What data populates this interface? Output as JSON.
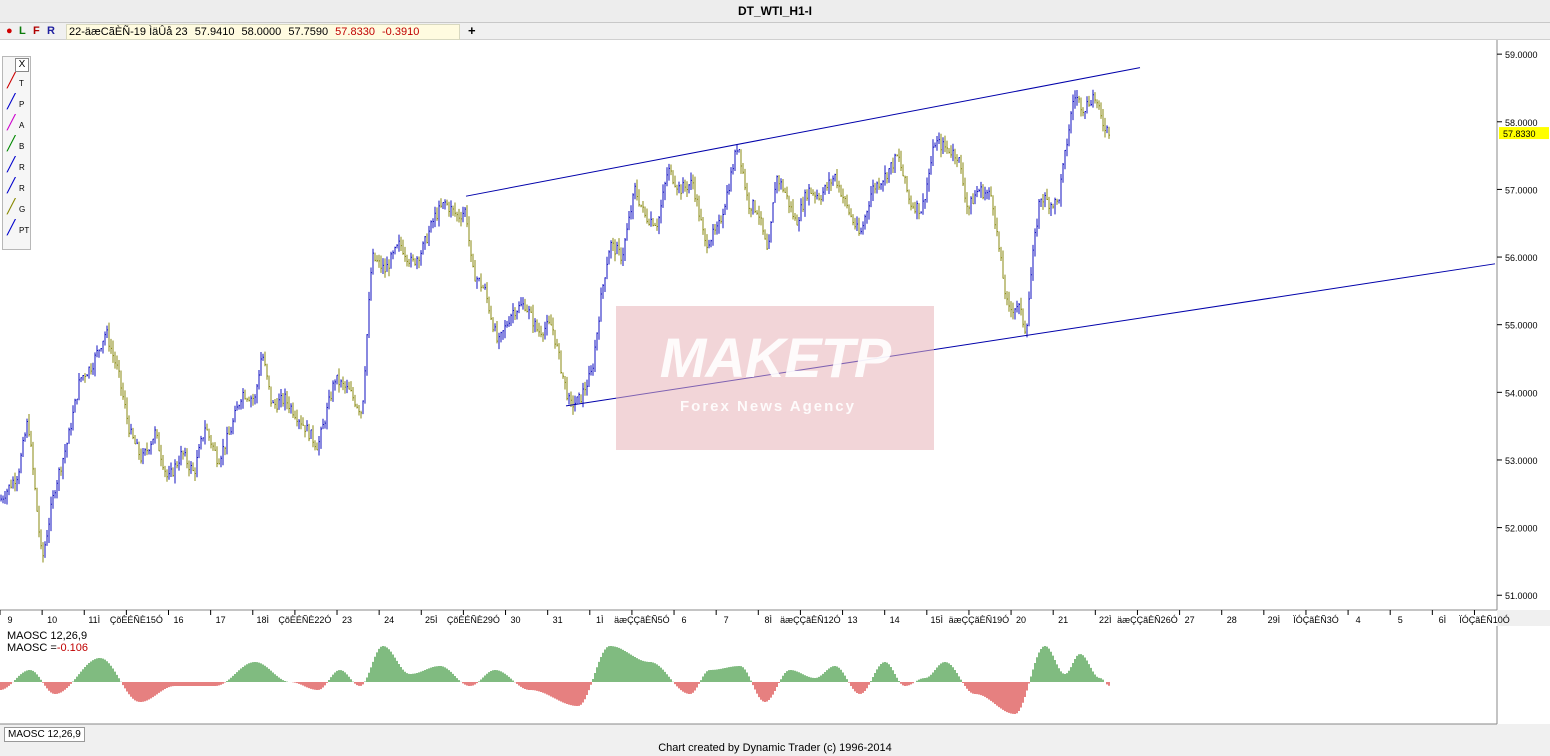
{
  "window": {
    "title": "DT_WTI_H1-I"
  },
  "toolbar": {
    "btn_dot": "●",
    "btn_l": "L",
    "btn_f": "F",
    "btn_r": "R",
    "ohlc": {
      "date": "22-äæCãÈÑ-19 ÌäÛå 23",
      "open": "57.9410",
      "high": "58.0000",
      "low": "57.7590",
      "close": "57.8330",
      "change": "-0.3910"
    },
    "add": "+"
  },
  "tools": {
    "close": "X",
    "items": [
      {
        "icon": "trend-line-icon",
        "sub": "T",
        "color": "#cc0000"
      },
      {
        "icon": "parallel-lines-icon",
        "sub": "P",
        "color": "#0000cc"
      },
      {
        "icon": "andrews-pitchfork-icon",
        "sub": "A",
        "color": "#cc00cc"
      },
      {
        "icon": "b-line-icon",
        "sub": "B",
        "color": "#008800"
      },
      {
        "icon": "r-ratio-icon",
        "sub": "R",
        "color": "#0000cc"
      },
      {
        "icon": "r-channel-icon",
        "sub": "R",
        "color": "#0000cc"
      },
      {
        "icon": "g-fan-icon",
        "sub": "G",
        "color": "#888800"
      },
      {
        "icon": "pt-icon",
        "sub": "PT",
        "color": "#0000cc"
      }
    ]
  },
  "watermark": {
    "logo": "MAKETP",
    "subtitle": "Forex News Agency"
  },
  "chart_data": {
    "type": "ohlc",
    "y_axis": {
      "range": [
        50.9,
        59.15
      ],
      "ticks": [
        "51.0000",
        "52.0000",
        "53.0000",
        "54.0000",
        "55.0000",
        "56.0000",
        "57.0000",
        "58.0000",
        "59.0000"
      ]
    },
    "last_price": "57.8330",
    "colors": {
      "up_bars": "#1010c0",
      "down_bars": "#8a8a10",
      "channel": "#0000aa",
      "axis_bg": "#ffffff",
      "marker": "#ffff00"
    },
    "date_labels": [
      "9",
      "10",
      "11Ì",
      "ÇõÈÉÑÈ15Ó",
      "16",
      "17",
      "18Ì",
      "ÇõÈÉÑÈ22Ó",
      "23",
      "24",
      "25Ì",
      "ÇõÈÉÑÈ29Ó",
      "30",
      "31",
      "1Ì",
      "äæÇÇãÈÑ5Ó",
      "6",
      "7",
      "8Ì",
      "äæÇÇãÈÑ12Ó",
      "13",
      "14",
      "15Ì",
      "äæÇÇãÈÑ19Ó",
      "20",
      "21",
      "22Ì",
      "äæÇÇãÈÑ26Ó",
      "27",
      "28",
      "29Ì",
      "ÏÓÇãÈÑ3Ó",
      "4",
      "5",
      "6Ì",
      "ÏÓÇãÈÑ10Ó"
    ],
    "price_path": [
      [
        0,
        52.4
      ],
      [
        18,
        52.8
      ],
      [
        28,
        53.6
      ],
      [
        42,
        51.5
      ],
      [
        55,
        52.6
      ],
      [
        68,
        53.3
      ],
      [
        80,
        54.2
      ],
      [
        92,
        54.4
      ],
      [
        106,
        54.9
      ],
      [
        118,
        54.3
      ],
      [
        130,
        53.4
      ],
      [
        142,
        53.0
      ],
      [
        155,
        53.4
      ],
      [
        168,
        52.7
      ],
      [
        182,
        53.1
      ],
      [
        194,
        52.8
      ],
      [
        205,
        53.5
      ],
      [
        218,
        53.0
      ],
      [
        230,
        53.4
      ],
      [
        242,
        54.0
      ],
      [
        255,
        53.9
      ],
      [
        262,
        54.6
      ],
      [
        272,
        53.8
      ],
      [
        285,
        53.9
      ],
      [
        300,
        53.6
      ],
      [
        318,
        53.2
      ],
      [
        335,
        54.2
      ],
      [
        350,
        54.0
      ],
      [
        362,
        53.7
      ],
      [
        372,
        56.0
      ],
      [
        385,
        55.8
      ],
      [
        400,
        56.2
      ],
      [
        412,
        55.9
      ],
      [
        422,
        56.1
      ],
      [
        435,
        56.6
      ],
      [
        445,
        56.8
      ],
      [
        458,
        56.6
      ],
      [
        466,
        56.7
      ],
      [
        472,
        55.8
      ],
      [
        485,
        55.5
      ],
      [
        498,
        54.7
      ],
      [
        512,
        55.2
      ],
      [
        525,
        55.3
      ],
      [
        538,
        54.9
      ],
      [
        552,
        55.0
      ],
      [
        562,
        54.3
      ],
      [
        570,
        53.8
      ],
      [
        580,
        53.9
      ],
      [
        592,
        54.3
      ],
      [
        602,
        55.5
      ],
      [
        610,
        56.2
      ],
      [
        622,
        56.0
      ],
      [
        635,
        57.0
      ],
      [
        645,
        56.6
      ],
      [
        658,
        56.5
      ],
      [
        668,
        57.3
      ],
      [
        680,
        57.0
      ],
      [
        693,
        57.1
      ],
      [
        705,
        56.2
      ],
      [
        718,
        56.4
      ],
      [
        728,
        57.0
      ],
      [
        738,
        57.7
      ],
      [
        748,
        56.8
      ],
      [
        758,
        56.7
      ],
      [
        768,
        56.0
      ],
      [
        776,
        57.2
      ],
      [
        784,
        57.0
      ],
      [
        796,
        56.5
      ],
      [
        808,
        57.0
      ],
      [
        820,
        56.9
      ],
      [
        835,
        57.2
      ],
      [
        848,
        56.7
      ],
      [
        860,
        56.3
      ],
      [
        872,
        57.0
      ],
      [
        885,
        57.2
      ],
      [
        898,
        57.5
      ],
      [
        910,
        56.8
      ],
      [
        922,
        56.7
      ],
      [
        935,
        57.7
      ],
      [
        948,
        57.6
      ],
      [
        958,
        57.5
      ],
      [
        968,
        56.7
      ],
      [
        978,
        57.0
      ],
      [
        992,
        56.9
      ],
      [
        1000,
        56.0
      ],
      [
        1008,
        55.2
      ],
      [
        1018,
        55.3
      ],
      [
        1026,
        54.9
      ],
      [
        1032,
        55.9
      ],
      [
        1040,
        56.9
      ],
      [
        1050,
        56.8
      ],
      [
        1058,
        56.8
      ],
      [
        1066,
        57.6
      ],
      [
        1074,
        58.4
      ],
      [
        1084,
        58.2
      ],
      [
        1094,
        58.4
      ],
      [
        1102,
        58.0
      ],
      [
        1110,
        57.85
      ]
    ],
    "channel_upper": [
      [
        466,
        56.9
      ],
      [
        1140,
        58.8
      ]
    ],
    "channel_lower": [
      [
        566,
        53.8
      ],
      [
        1495,
        55.9
      ]
    ],
    "oscillator": {
      "name": "MAOSC 12,26,9",
      "value_label": "MAOSC =",
      "value": "-0.106",
      "tab": "MAOSC 12,26,9",
      "colors": {
        "positive": "#007700",
        "negative": "#cc0000"
      },
      "peaks": [
        [
          0,
          -0.2
        ],
        [
          30,
          0.3
        ],
        [
          55,
          -0.3
        ],
        [
          100,
          0.6
        ],
        [
          140,
          -0.5
        ],
        [
          175,
          -0.1
        ],
        [
          215,
          -0.1
        ],
        [
          255,
          0.5
        ],
        [
          290,
          0.0
        ],
        [
          318,
          -0.2
        ],
        [
          340,
          0.3
        ],
        [
          360,
          -0.1
        ],
        [
          383,
          0.9
        ],
        [
          410,
          0.2
        ],
        [
          440,
          0.4
        ],
        [
          470,
          -0.1
        ],
        [
          495,
          0.3
        ],
        [
          530,
          -0.2
        ],
        [
          578,
          -0.6
        ],
        [
          610,
          0.9
        ],
        [
          650,
          0.5
        ],
        [
          690,
          -0.3
        ],
        [
          710,
          0.3
        ],
        [
          740,
          0.4
        ],
        [
          765,
          -0.5
        ],
        [
          790,
          0.3
        ],
        [
          815,
          0.1
        ],
        [
          835,
          0.4
        ],
        [
          860,
          -0.3
        ],
        [
          885,
          0.5
        ],
        [
          905,
          -0.1
        ],
        [
          925,
          0.1
        ],
        [
          945,
          0.5
        ],
        [
          975,
          -0.3
        ],
        [
          1015,
          -0.8
        ],
        [
          1045,
          0.9
        ],
        [
          1065,
          0.2
        ],
        [
          1080,
          0.7
        ],
        [
          1100,
          0.1
        ],
        [
          1110,
          -0.1
        ]
      ]
    }
  },
  "footer": {
    "credit": "Chart created by Dynamic Trader  (c) 1996-2014"
  }
}
